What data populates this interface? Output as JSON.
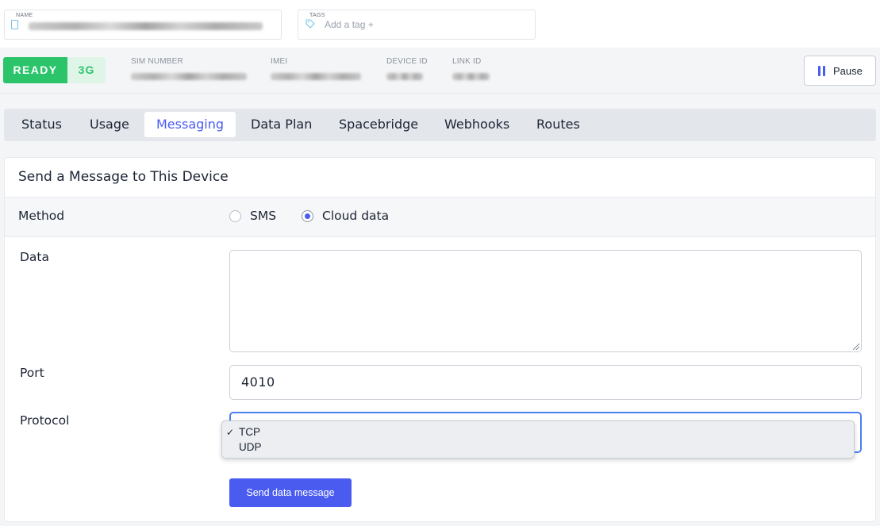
{
  "header": {
    "name_label": "NAME",
    "tags_label": "TAGS",
    "tags_placeholder": "Add a tag +"
  },
  "status": {
    "state": "READY",
    "network": "3G",
    "state_color": "#2cc46b",
    "meta": [
      {
        "label": "SIM NUMBER"
      },
      {
        "label": "IMEI"
      },
      {
        "label": "DEVICE ID"
      },
      {
        "label": "LINK ID"
      }
    ],
    "pause_label": "Pause"
  },
  "tabs": [
    {
      "label": "Status"
    },
    {
      "label": "Usage"
    },
    {
      "label": "Messaging"
    },
    {
      "label": "Data Plan"
    },
    {
      "label": "Spacebridge"
    },
    {
      "label": "Webhooks"
    },
    {
      "label": "Routes"
    }
  ],
  "active_tab": "Messaging",
  "form": {
    "title": "Send a Message to This Device",
    "method_label": "Method",
    "methods": [
      {
        "label": "SMS",
        "selected": false
      },
      {
        "label": "Cloud data",
        "selected": true
      }
    ],
    "data_label": "Data",
    "data_value": "",
    "port_label": "Port",
    "port_value": "4010",
    "protocol_label": "Protocol",
    "protocol_options": [
      {
        "label": "TCP",
        "selected": true
      },
      {
        "label": "UDP",
        "selected": false
      }
    ],
    "send_label": "Send data message"
  },
  "colors": {
    "accent": "#4a5cf0",
    "success": "#2cc46b",
    "focus": "#4a7ff0"
  }
}
